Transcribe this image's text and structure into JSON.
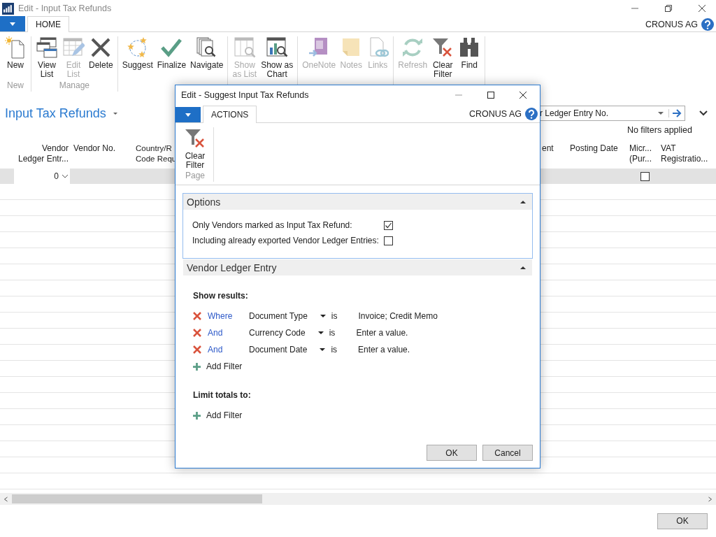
{
  "window": {
    "title": "Edit - Input Tax Refunds",
    "company": "CRONUS AG"
  },
  "ribbon": {
    "tabs": [
      {
        "label": "HOME",
        "selected": true
      }
    ],
    "groups": [
      {
        "label": "New",
        "actions": [
          {
            "label": "New",
            "kind": "new",
            "disabled": false
          }
        ]
      },
      {
        "label": "Manage",
        "actions": [
          {
            "label": "View\nList",
            "kind": "view-list",
            "disabled": false
          },
          {
            "label": "Edit\nList",
            "kind": "edit-list",
            "disabled": true
          },
          {
            "label": "Delete",
            "kind": "delete",
            "disabled": false
          }
        ]
      },
      {
        "actions": [
          {
            "label": "Suggest",
            "kind": "suggest",
            "disabled": false
          },
          {
            "label": "Finalize",
            "kind": "finalize",
            "disabled": false
          },
          {
            "label": "Navigate",
            "kind": "navigate",
            "disabled": false
          }
        ]
      },
      {
        "actions": [
          {
            "label": "Show\nas List",
            "kind": "show-as-list",
            "disabled": true
          },
          {
            "label": "Show as\nChart",
            "kind": "show-as-chart",
            "disabled": false
          }
        ]
      },
      {
        "actions": [
          {
            "label": "OneNote",
            "kind": "onenote",
            "disabled": true
          },
          {
            "label": "Notes",
            "kind": "notes",
            "disabled": true
          },
          {
            "label": "Links",
            "kind": "links",
            "disabled": true
          }
        ]
      },
      {
        "actions": [
          {
            "label": "Refresh",
            "kind": "refresh",
            "disabled": true
          },
          {
            "label": "Clear\nFilter",
            "kind": "clear-filter",
            "disabled": false
          },
          {
            "label": "Find",
            "kind": "find",
            "disabled": false
          }
        ]
      }
    ]
  },
  "page": {
    "title": "Input Tax Refunds",
    "search": {
      "value": "r Ledger Entry No."
    },
    "filter_status": "No filters applied"
  },
  "table": {
    "columns": [
      {
        "lines": [
          "Vendor",
          "Ledger Entr..."
        ]
      },
      {
        "lines": [
          "Vendor No."
        ]
      },
      {
        "lines": [
          "Country/R",
          "Code Requ"
        ]
      },
      {
        "lines": [
          "ent"
        ]
      },
      {
        "lines": [
          "Posting Date"
        ]
      },
      {
        "lines": [
          "Micr...",
          "(Pur..."
        ]
      },
      {
        "lines": [
          "VAT",
          "Registratio..."
        ]
      }
    ],
    "rows": [
      {
        "selected": true,
        "cells": [
          {
            "kind": "lookup",
            "text": "0"
          },
          {
            "kind": "blank"
          },
          {
            "kind": "blank"
          },
          {
            "kind": "blank"
          },
          {
            "kind": "blank"
          },
          {
            "kind": "checkbox",
            "checked": false
          },
          {
            "kind": "blank"
          }
        ]
      }
    ]
  },
  "buttons": [
    "OK"
  ],
  "dialog": {
    "title": "Edit - Suggest Input Tax Refunds",
    "company": "CRONUS AG",
    "tabs": [
      {
        "label": "ACTIONS",
        "selected": true
      }
    ],
    "groups": [
      {
        "label": "Page",
        "actions": [
          {
            "label": "Clear\nFilter",
            "kind": "clear-filter",
            "disabled": false
          }
        ]
      }
    ],
    "options": {
      "title": "Options",
      "expanded": true,
      "focused": true,
      "fields": [
        {
          "label": "Only Vendors marked as Input Tax Refund:",
          "checked": true
        },
        {
          "label": "Including already exported Vendor Ledger Entries:",
          "checked": false
        }
      ]
    },
    "filter_section": {
      "title": "Vendor Ledger Entry",
      "expanded": true,
      "show_results": {
        "heading": "Show results:",
        "filters": [
          {
            "conjunction": "Where",
            "field": "Document Type",
            "operator": "is",
            "value": "Invoice; Credit Memo"
          },
          {
            "conjunction": "And",
            "field": "Currency Code",
            "operator": "is",
            "value": "Enter a value."
          },
          {
            "conjunction": "And",
            "field": "Document Date",
            "operator": "is",
            "value": "Enter a value."
          }
        ],
        "add_filter": "Add Filter"
      },
      "limit_totals": {
        "heading": "Limit totals to:",
        "add_filter": "Add Filter"
      }
    },
    "buttons": [
      "OK",
      "Cancel"
    ]
  }
}
